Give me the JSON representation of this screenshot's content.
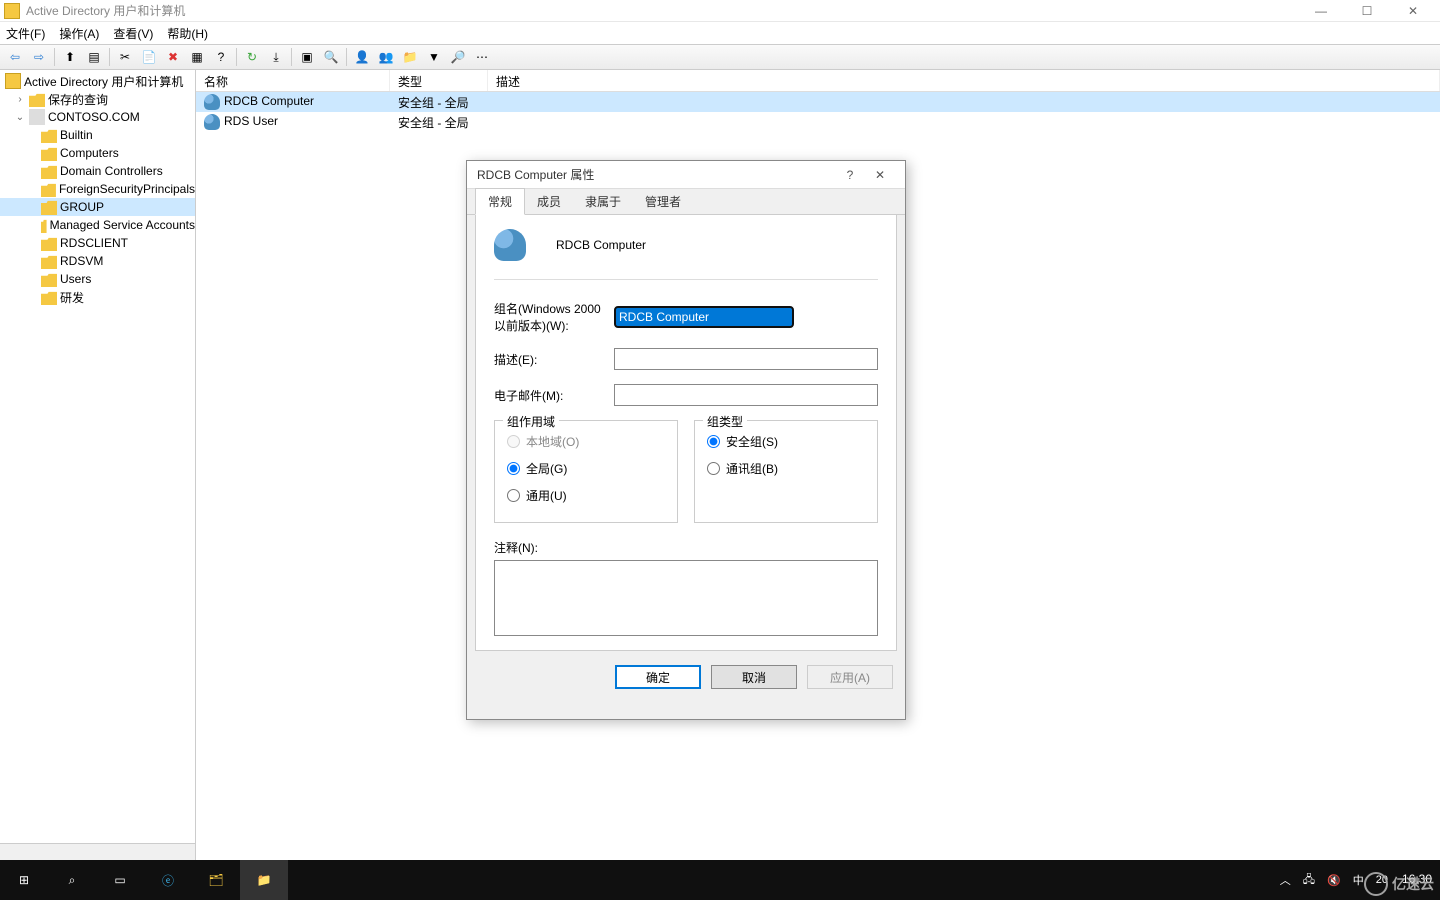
{
  "window": {
    "title": "Active Directory 用户和计算机"
  },
  "menu": {
    "file": "文件(F)",
    "action": "操作(A)",
    "view": "查看(V)",
    "help": "帮助(H)"
  },
  "tree": {
    "root": "Active Directory 用户和计算机",
    "saved": "保存的查询",
    "domain": "CONTOSO.COM",
    "nodes": [
      "Builtin",
      "Computers",
      "Domain Controllers",
      "ForeignSecurityPrincipals",
      "GROUP",
      "Managed Service Accounts",
      "RDSCLIENT",
      "RDSVM",
      "Users",
      "研发"
    ],
    "selected": "GROUP"
  },
  "list": {
    "cols": {
      "name": "名称",
      "type": "类型",
      "desc": "描述"
    },
    "rows": [
      {
        "name": "RDCB Computer",
        "type": "安全组 - 全局",
        "selected": true
      },
      {
        "name": "RDS User",
        "type": "安全组 - 全局",
        "selected": false
      }
    ]
  },
  "dialog": {
    "title": "RDCB Computer 属性",
    "tabs": {
      "general": "常规",
      "members": "成员",
      "memberof": "隶属于",
      "managed": "管理者"
    },
    "heading": "RDCB Computer",
    "labels": {
      "groupname": "组名(Windows 2000 以前版本)(W):",
      "desc": "描述(E):",
      "email": "电子邮件(M):",
      "scope": "组作用域",
      "scope_local": "本地域(O)",
      "scope_global": "全局(G)",
      "scope_universal": "通用(U)",
      "type": "组类型",
      "type_security": "安全组(S)",
      "type_dist": "通讯组(B)",
      "notes": "注释(N):"
    },
    "values": {
      "groupname": "RDCB Computer",
      "desc": "",
      "email": "",
      "notes": ""
    },
    "buttons": {
      "ok": "确定",
      "cancel": "取消",
      "apply": "应用(A)"
    }
  },
  "taskbar": {
    "clock_time": "16:30",
    "clock_lang": "中",
    "tray_num": "20"
  },
  "watermark": "亿速云"
}
